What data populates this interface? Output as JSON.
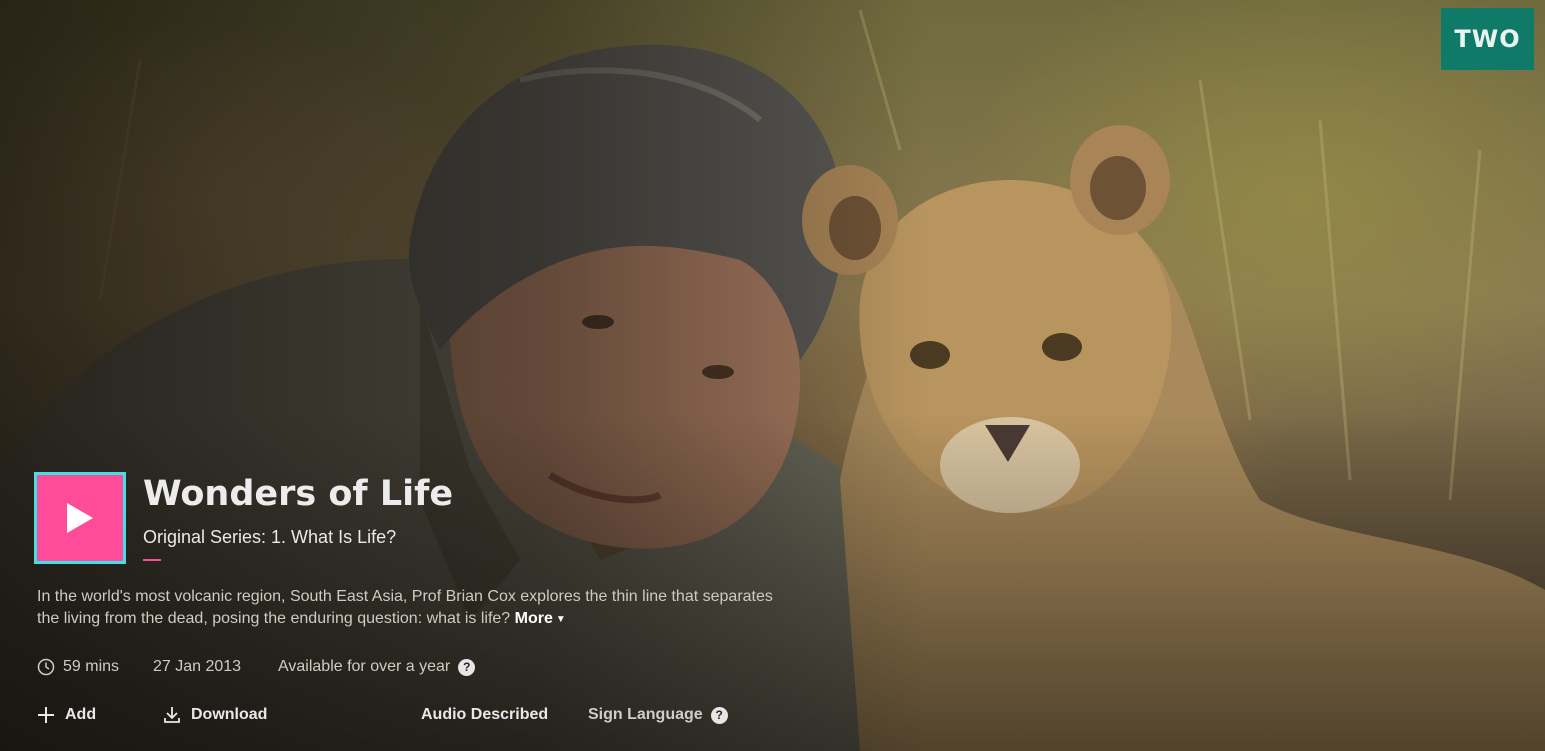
{
  "channel": {
    "badge_label": "TWO",
    "badge_color": "#0f7a68"
  },
  "programme": {
    "title": "Wonders of Life",
    "subtitle": "Original Series: 1. What Is Life?",
    "description": "In the world's most volcanic region, South East Asia, Prof Brian Cox explores the thin line that separates the living from the dead, posing the enduring question: what is life?",
    "more_label": "More"
  },
  "meta": {
    "duration": "59 mins",
    "date": "27 Jan 2013",
    "availability": "Available for over a year",
    "help_icon": "?"
  },
  "actions": {
    "add_label": "Add",
    "download_label": "Download",
    "audio_described_label": "Audio Described",
    "sign_language_label": "Sign Language",
    "help_icon": "?"
  },
  "colors": {
    "play_button": "#ff4c98",
    "play_focus_border": "#3fe0e6",
    "accent": "#ff4c98"
  },
  "icons": [
    "play-icon",
    "clock-icon",
    "plus-icon",
    "download-icon",
    "help-icon",
    "chevron-down-icon"
  ]
}
